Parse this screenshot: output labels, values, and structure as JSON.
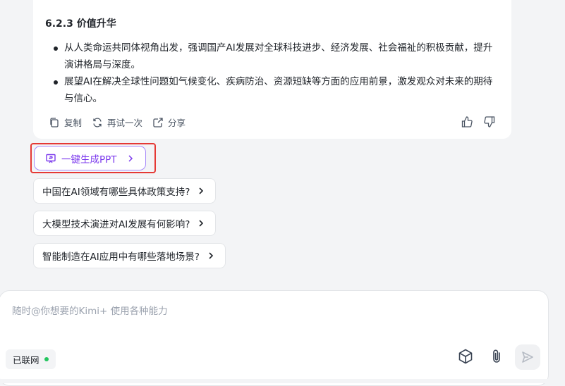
{
  "answer": {
    "section_title": "6.2.3 价值升华",
    "bullets": [
      "从人类命运共同体视角出发，强调国产AI发展对全球科技进步、经济发展、社会福祉的积极贡献，提升演讲格局与深度。",
      "展望AI在解决全球性问题如气候变化、疾病防治、资源短缺等方面的应用前景，激发观众对未来的期待与信心。"
    ],
    "actions": {
      "copy": "复制",
      "retry": "再试一次",
      "share": "分享"
    }
  },
  "ppt_button": {
    "label": "一键生成PPT"
  },
  "suggestions": [
    "中国在AI领域有哪些具体政策支持?",
    "大模型技术演进对AI发展有何影响?",
    "智能制造在AI应用中有哪些落地场景?"
  ],
  "composer": {
    "placeholder": "随时@你想要的Kimi+ 使用各种能力",
    "network_badge": "已联网"
  },
  "colors": {
    "accent": "#7c3aed",
    "highlight_border": "#e53935",
    "online_dot": "#22c55e",
    "background": "#f3f4f6"
  },
  "icons": [
    "copy-icon",
    "retry-icon",
    "share-icon",
    "thumbs-up-icon",
    "thumbs-down-icon",
    "ppt-icon",
    "chevron-right-icon",
    "cube-icon",
    "paperclip-icon",
    "send-icon"
  ]
}
